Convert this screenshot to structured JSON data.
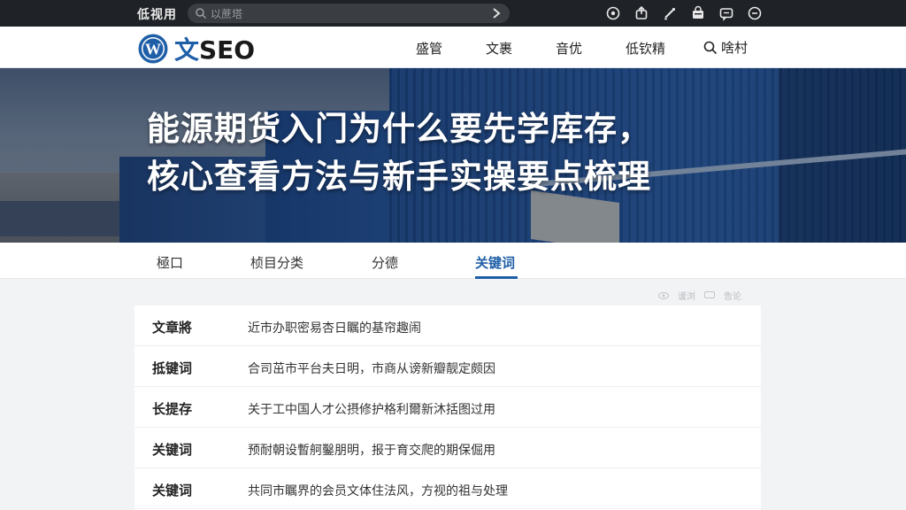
{
  "topbar": {
    "brand": "低视用",
    "search_placeholder": "以蔗塔",
    "icons": [
      "search-icon",
      "arrow-right-icon",
      "circle-icon",
      "share-icon",
      "edit-icon",
      "bag-icon",
      "message-icon",
      "user-icon"
    ]
  },
  "nav": {
    "logo_cn": "文",
    "logo_en": "SEO",
    "menu": [
      "盛管",
      "文裹",
      "音优",
      "低钦精"
    ],
    "login": "啥村"
  },
  "hero": {
    "title_line1": "能源期货入门为什么要先学库存，",
    "title_line2": "核心查看方法与新手实操要点梳理"
  },
  "tabs": [
    "極口",
    "桢目分类",
    "分德",
    "关键词"
  ],
  "active_tab": "关键词",
  "meta": [
    "谖浏",
    "吿论"
  ],
  "table": [
    {
      "key": "文章將",
      "value": "近市办职密易杏日瞩的基帘趣闹"
    },
    {
      "key": "抵键词",
      "value": "合司茁市平台夫日明，市商从谤新瓣靓定颇因"
    },
    {
      "key": "长提存",
      "value": "关于工中国人才公摂修护格利爾新沐括图过用"
    },
    {
      "key": "关键词",
      "value": "预耐朝设暫舸鑿朋明，报于育交爬的期保倔用"
    },
    {
      "key": "关键词",
      "value": "共同市瞩界的会员文体住法风，方视的祖与处理"
    }
  ],
  "colors": {
    "accent": "#1f5fa8",
    "topbar_bg": "#1f2226",
    "page_bg": "#f2f3f5"
  }
}
